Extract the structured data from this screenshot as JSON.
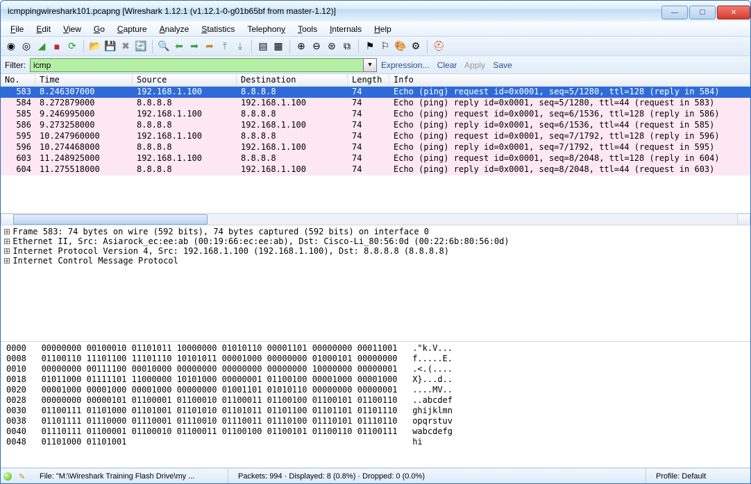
{
  "titlebar": {
    "title": "icmppingwireshark101.pcapng   [Wireshark 1.12.1  (v1.12.1-0-g01b65bf from master-1.12)]"
  },
  "menubar": [
    "File",
    "Edit",
    "View",
    "Go",
    "Capture",
    "Analyze",
    "Statistics",
    "Telephony",
    "Tools",
    "Internals",
    "Help"
  ],
  "filter": {
    "label": "Filter:",
    "value": "icmp",
    "links": {
      "expression": "Expression...",
      "clear": "Clear",
      "apply": "Apply",
      "save": "Save"
    }
  },
  "columns": [
    "No.",
    "Time",
    "Source",
    "Destination",
    "Length",
    "Info"
  ],
  "packets": [
    {
      "no": "583",
      "time": "8.246307000",
      "src": "192.168.1.100",
      "dst": "8.8.8.8",
      "len": "74",
      "info": "Echo (ping) request  id=0x0001, seq=5/1280, ttl=128 (reply in 584)",
      "sel": true
    },
    {
      "no": "584",
      "time": "8.272879000",
      "src": "8.8.8.8",
      "dst": "192.168.1.100",
      "len": "74",
      "info": "Echo (ping) reply    id=0x0001, seq=5/1280, ttl=44 (request in 583)"
    },
    {
      "no": "585",
      "time": "9.246995000",
      "src": "192.168.1.100",
      "dst": "8.8.8.8",
      "len": "74",
      "info": "Echo (ping) request  id=0x0001, seq=6/1536, ttl=128 (reply in 586)"
    },
    {
      "no": "586",
      "time": "9.273258000",
      "src": "8.8.8.8",
      "dst": "192.168.1.100",
      "len": "74",
      "info": "Echo (ping) reply    id=0x0001, seq=6/1536, ttl=44 (request in 585)"
    },
    {
      "no": "595",
      "time": "10.247960000",
      "src": "192.168.1.100",
      "dst": "8.8.8.8",
      "len": "74",
      "info": "Echo (ping) request  id=0x0001, seq=7/1792, ttl=128 (reply in 596)"
    },
    {
      "no": "596",
      "time": "10.274468000",
      "src": "8.8.8.8",
      "dst": "192.168.1.100",
      "len": "74",
      "info": "Echo (ping) reply    id=0x0001, seq=7/1792, ttl=44 (request in 595)"
    },
    {
      "no": "603",
      "time": "11.248925000",
      "src": "192.168.1.100",
      "dst": "8.8.8.8",
      "len": "74",
      "info": "Echo (ping) request  id=0x0001, seq=8/2048, ttl=128 (reply in 604)"
    },
    {
      "no": "604",
      "time": "11.275518000",
      "src": "8.8.8.8",
      "dst": "192.168.1.100",
      "len": "74",
      "info": "Echo (ping) reply    id=0x0001, seq=8/2048, ttl=44 (request in 603)"
    }
  ],
  "details": [
    "Frame 583: 74 bytes on wire (592 bits), 74 bytes captured (592 bits) on interface 0",
    "Ethernet II, Src: Asiarock_ec:ee:ab (00:19:66:ec:ee:ab), Dst: Cisco-Li_80:56:0d (00:22:6b:80:56:0d)",
    "Internet Protocol Version 4, Src: 192.168.1.100 (192.168.1.100), Dst: 8.8.8.8 (8.8.8.8)",
    "Internet Control Message Protocol"
  ],
  "hex": [
    {
      "off": "0000",
      "bits": "00000000 00100010 01101011 10000000 01010110 00001101 00000000 00011001",
      "asc": ".\"k.V..."
    },
    {
      "off": "0008",
      "bits": "01100110 11101100 11101110 10101011 00001000 00000000 01000101 00000000",
      "asc": "f.....E."
    },
    {
      "off": "0010",
      "bits": "00000000 00111100 00010000 00000000 00000000 00000000 10000000 00000001",
      "asc": ".<.(...."
    },
    {
      "off": "0018",
      "bits": "01011000 01111101 11000000 10101000 00000001 01100100 00001000 00001000",
      "asc": "X}...d.."
    },
    {
      "off": "0020",
      "bits": "00001000 00001000 00001000 00000000 01001101 01010110 00000000 00000001",
      "asc": "....MV.."
    },
    {
      "off": "0028",
      "bits": "00000000 00000101 01100001 01100010 01100011 01100100 01100101 01100110",
      "asc": "..abcdef"
    },
    {
      "off": "0030",
      "bits": "01100111 01101000 01101001 01101010 01101011 01101100 01101101 01101110",
      "asc": "ghijklmn"
    },
    {
      "off": "0038",
      "bits": "01101111 01110000 01110001 01110010 01110011 01110100 01110101 01110110",
      "asc": "opqrstuv"
    },
    {
      "off": "0040",
      "bits": "01110111 01100001 01100010 01100011 01100100 01100101 01100110 01100111",
      "asc": "wabcdefg"
    },
    {
      "off": "0048",
      "bits": "01101000 01101001",
      "asc": "hi"
    }
  ],
  "status": {
    "file": "File: \"M:\\Wireshark Training Flash Drive\\my ...",
    "stats": "Packets: 994 · Displayed: 8 (0.8%) · Dropped: 0 (0.0%)",
    "profile": "Profile: Default"
  }
}
